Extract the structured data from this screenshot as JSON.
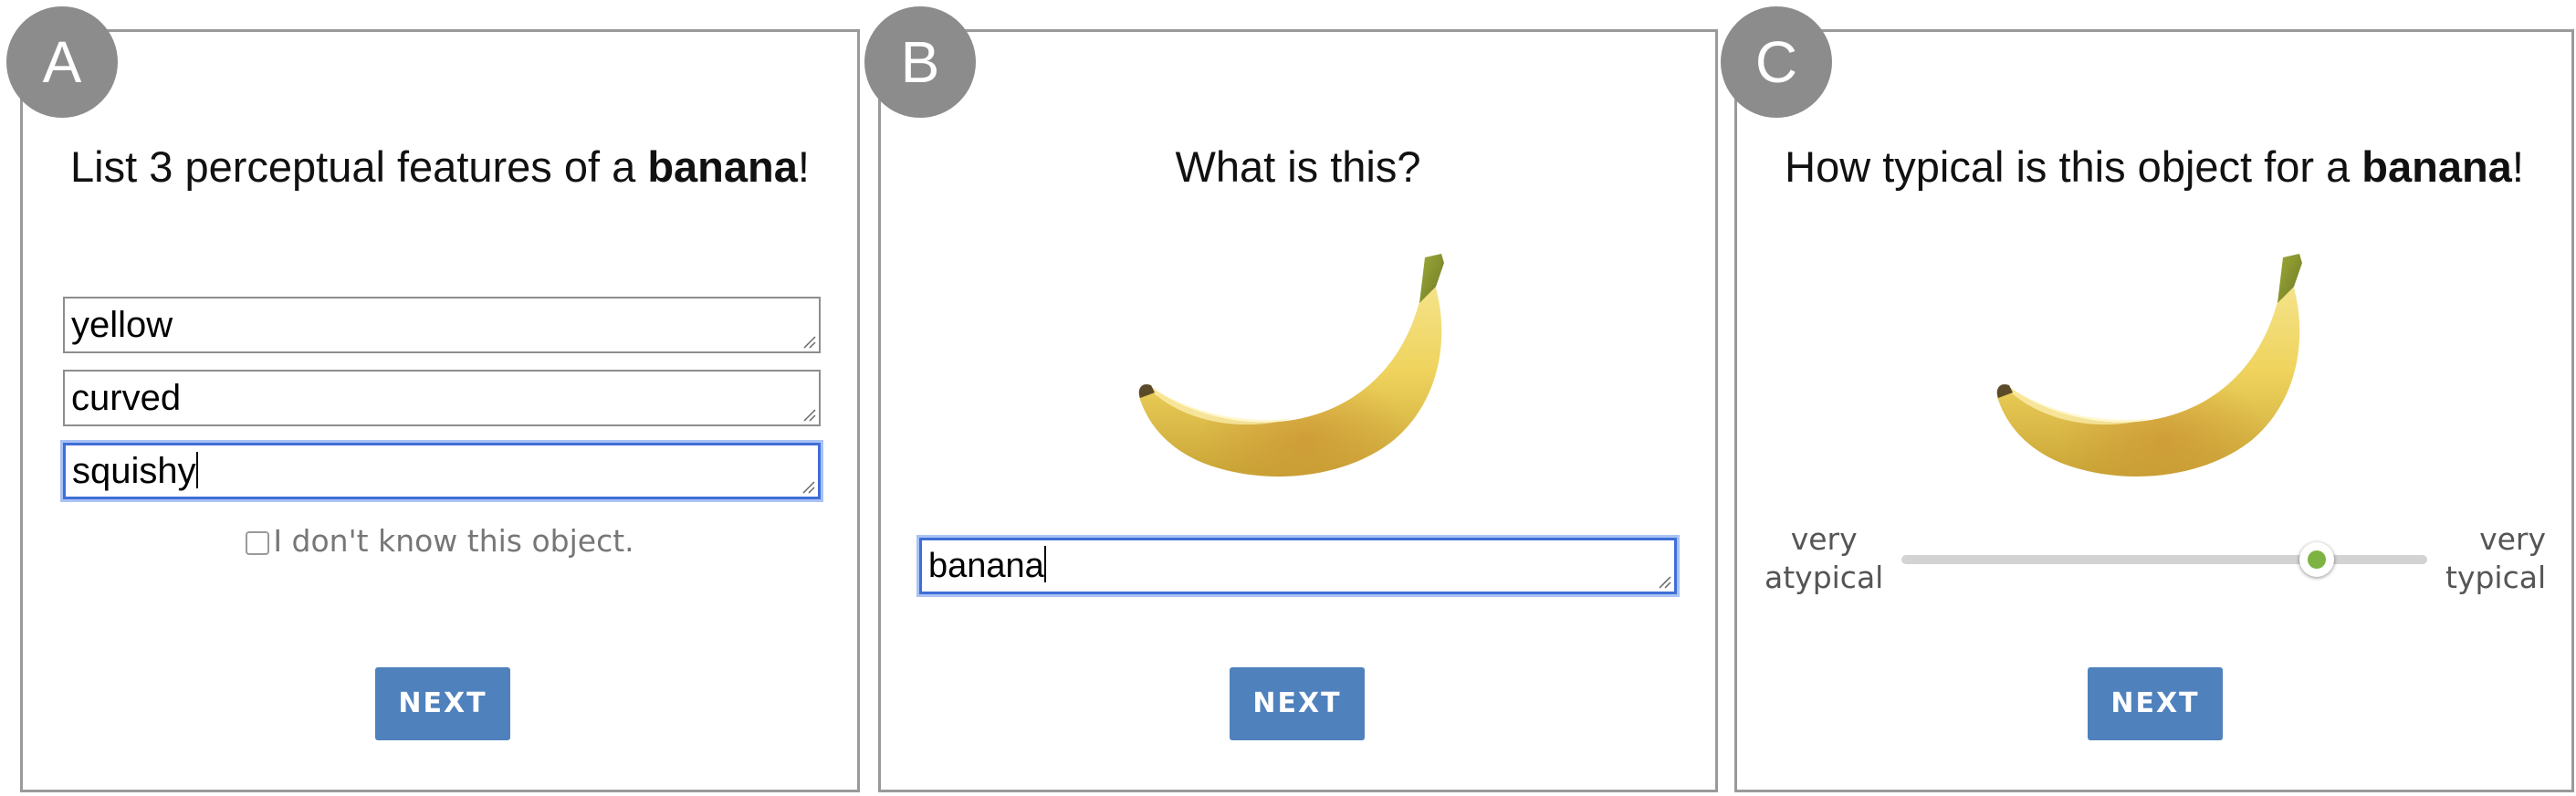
{
  "panel_a": {
    "badge": "A",
    "prompt_prefix": "List 3 perceptual features of a ",
    "prompt_object": "banana",
    "prompt_suffix": "!",
    "features": [
      "yellow",
      "curved",
      "squishy"
    ],
    "checkbox_label": "I don't know this object.",
    "checkbox_checked": false,
    "next_label": "NEXT"
  },
  "panel_b": {
    "badge": "B",
    "prompt": "What is this?",
    "image": "banana",
    "answer": "banana",
    "next_label": "NEXT"
  },
  "panel_c": {
    "badge": "C",
    "prompt_prefix": "How typical is this object for a ",
    "prompt_object": "banana",
    "prompt_suffix": "!",
    "image": "banana",
    "slider_left_label_1": "very",
    "slider_left_label_2": "atypical",
    "slider_right_label_1": "very",
    "slider_right_label_2": "typical",
    "slider_value": 0.79,
    "next_label": "NEXT"
  },
  "colors": {
    "badge": "#8c8c8c",
    "next_button": "#4f81bd",
    "focus_ring": "#3f6fd6",
    "slider_thumb": "#7cb342",
    "slider_track": "#d3d3d3"
  }
}
